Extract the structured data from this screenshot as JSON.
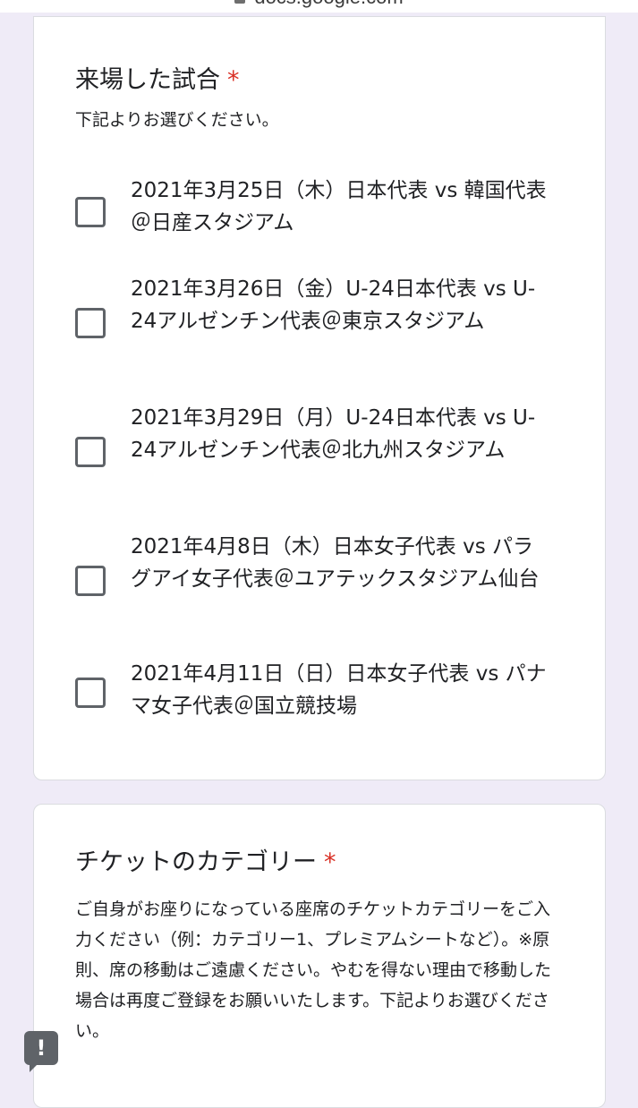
{
  "browser": {
    "domain": "docs.google.com",
    "lock_icon": "lock-icon"
  },
  "colors": {
    "background": "#efebf7",
    "required": "#d93025",
    "checkbox_border": "#5f6368"
  },
  "question1": {
    "title": "来場した試合",
    "required_mark": "*",
    "description": "下記よりお選びください。",
    "options": [
      {
        "label": "2021年3月25日（木）日本代表 vs 韓国代表＠日産スタジアム",
        "checked": false
      },
      {
        "label": "2021年3月26日（金）U-24日本代表 vs U-24アルゼンチン代表＠東京スタジアム",
        "checked": false
      },
      {
        "label": "2021年3月29日（月）U-24日本代表 vs U-24アルゼンチン代表＠北九州スタジアム",
        "checked": false
      },
      {
        "label": "2021年4月8日（木）日本女子代表 vs パラグアイ女子代表＠ユアテックスタジアム仙台",
        "checked": false
      },
      {
        "label": "2021年4月11日（日）日本女子代表 vs パナマ女子代表＠国立競技場",
        "checked": false
      }
    ]
  },
  "question2": {
    "title": "チケットのカテゴリー",
    "required_mark": "*",
    "description": "ご自身がお座りになっている座席のチケットカテゴリーをご入力ください（例：カテゴリー1、プレミアムシートなど）。※原則、席の移動はご遠慮ください。やむを得ない理由で移動した場合は再度ご登録をお願いいたします。下記よりお選びください。"
  },
  "feedback": {
    "glyph": "!"
  }
}
